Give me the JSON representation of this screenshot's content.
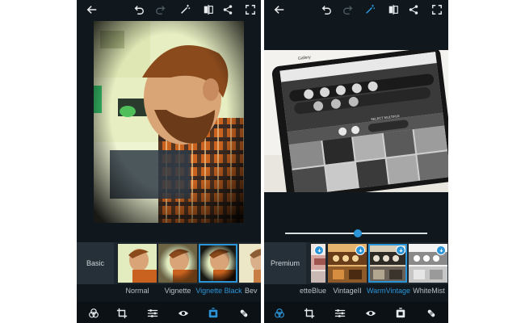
{
  "left_screen": {
    "category_label": "Basic",
    "filters": [
      {
        "label": "Normal",
        "selected": false
      },
      {
        "label": "Vignette",
        "selected": false
      },
      {
        "label": "Vignette Black",
        "selected": true
      },
      {
        "label": "Bev",
        "selected": false
      }
    ],
    "active_tool": "looks-icon"
  },
  "right_screen": {
    "category_label": "Premium",
    "slider_value_fraction": 0.51,
    "phone_in_photo": {
      "header_text": "Gallery",
      "select_multiple_text": "SELECT MULTIPLE"
    },
    "filters": [
      {
        "label": "etteBlue",
        "selected": false
      },
      {
        "label": "VintageII",
        "selected": false
      },
      {
        "label": "WarmVintage",
        "selected": true
      },
      {
        "label": "WhiteMist",
        "selected": false
      }
    ],
    "active_tool": "filters-icon"
  },
  "colors": {
    "accent": "#2c95d8",
    "background": "#10171d",
    "strip": "#1d262d",
    "text": "#b9c1c6"
  }
}
